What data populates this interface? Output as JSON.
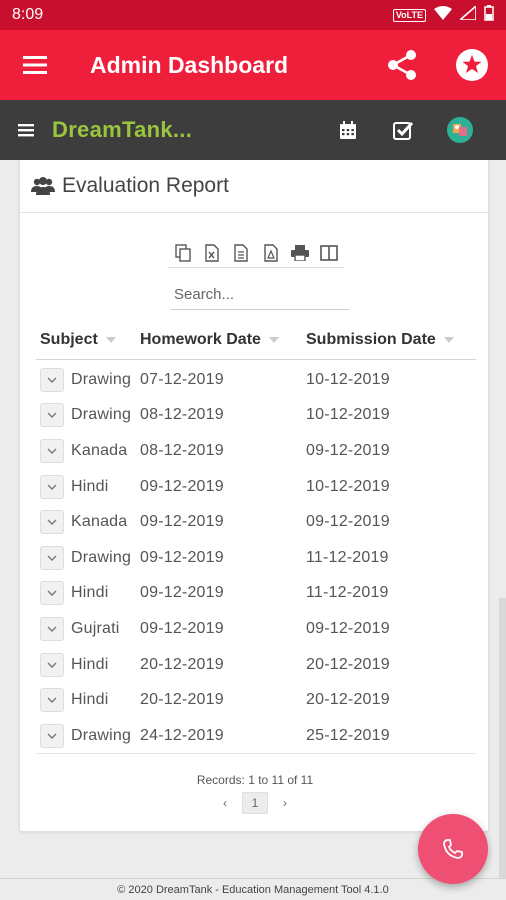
{
  "status_bar": {
    "time": "8:09",
    "network": "VoLTE"
  },
  "app_bar": {
    "title": "Admin Dashboard"
  },
  "sub_bar": {
    "brand": "DreamTank..."
  },
  "card": {
    "title": "Evaluation Report"
  },
  "export_tools": [
    "copy-icon",
    "excel-icon",
    "csv-icon",
    "pdf-icon",
    "print-icon",
    "columns-icon"
  ],
  "search": {
    "placeholder": "Search..."
  },
  "table": {
    "headers": [
      "Subject",
      "Homework Date",
      "Submission Date"
    ],
    "rows": [
      [
        "Drawing",
        "07-12-2019",
        "10-12-2019"
      ],
      [
        "Drawing",
        "08-12-2019",
        "10-12-2019"
      ],
      [
        "Kanada",
        "08-12-2019",
        "09-12-2019"
      ],
      [
        "Hindi",
        "09-12-2019",
        "10-12-2019"
      ],
      [
        "Kanada",
        "09-12-2019",
        "09-12-2019"
      ],
      [
        "Drawing",
        "09-12-2019",
        "11-12-2019"
      ],
      [
        "Hindi",
        "09-12-2019",
        "11-12-2019"
      ],
      [
        "Gujrati",
        "09-12-2019",
        "09-12-2019"
      ],
      [
        "Hindi",
        "20-12-2019",
        "20-12-2019"
      ],
      [
        "Hindi",
        "20-12-2019",
        "20-12-2019"
      ],
      [
        "Drawing",
        "24-12-2019",
        "25-12-2019"
      ]
    ]
  },
  "pagination": {
    "records_text": "Records: 1 to 11 of 11",
    "prev": "‹",
    "current": "1",
    "next": "›"
  },
  "footer": {
    "text": "© 2020 DreamTank - Education Management Tool 4.1.0"
  },
  "colors": {
    "status": "#c8102e",
    "app_bar": "#ef1f3c",
    "sub_bar": "#3d3d3d",
    "brand": "#9bc53d",
    "fab": "#ef4f72"
  }
}
